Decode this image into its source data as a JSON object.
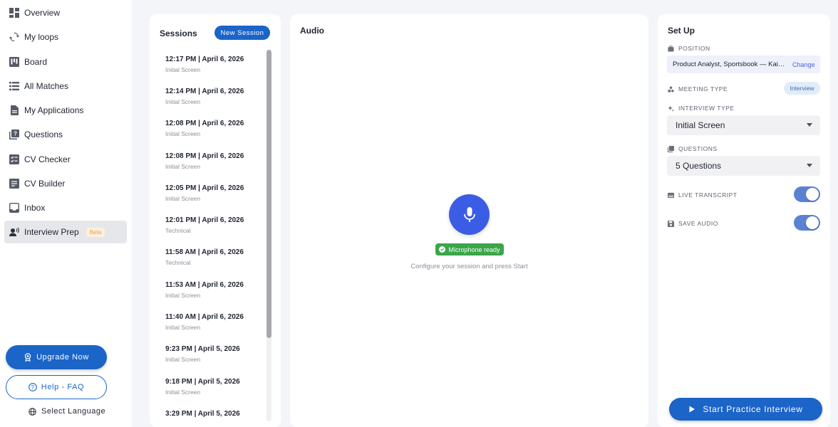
{
  "sidebar": {
    "items": [
      {
        "label": "Overview",
        "icon": "dashboard-icon"
      },
      {
        "label": "My loops",
        "icon": "refresh-icon"
      },
      {
        "label": "Board",
        "icon": "kanban-icon"
      },
      {
        "label": "All Matches",
        "icon": "list-icon"
      },
      {
        "label": "My Applications",
        "icon": "document-icon"
      },
      {
        "label": "Questions",
        "icon": "question-box-icon"
      },
      {
        "label": "CV Checker",
        "icon": "checklist-icon"
      },
      {
        "label": "CV Builder",
        "icon": "article-icon"
      },
      {
        "label": "Inbox",
        "icon": "inbox-icon"
      },
      {
        "label": "Interview Prep",
        "icon": "person-voice-icon",
        "badge": "Beta",
        "active": true
      }
    ],
    "upgrade_label": "Upgrade Now",
    "faq_label": "Help - FAQ",
    "language_label": "Select Language"
  },
  "sessions": {
    "title": "Sessions",
    "new_button": "New Session",
    "items": [
      {
        "time": "12:17 PM | April 6, 2026",
        "type": "Initial Screen"
      },
      {
        "time": "12:14 PM | April 6, 2026",
        "type": "Initial Screen"
      },
      {
        "time": "12:08 PM | April 6, 2026",
        "type": "Initial Screen"
      },
      {
        "time": "12:08 PM | April 6, 2026",
        "type": "Initial Screen"
      },
      {
        "time": "12:05 PM | April 6, 2026",
        "type": "Initial Screen"
      },
      {
        "time": "12:01 PM | April 6, 2026",
        "type": "Technical"
      },
      {
        "time": "11:58 AM | April 6, 2026",
        "type": "Technical"
      },
      {
        "time": "11:53 AM | April 6, 2026",
        "type": "Initial Screen"
      },
      {
        "time": "11:40 AM | April 6, 2026",
        "type": "Initial Screen"
      },
      {
        "time": "9:23 PM | April 5, 2026",
        "type": "Initial Screen"
      },
      {
        "time": "9:18 PM | April 5, 2026",
        "type": "Initial Screen"
      },
      {
        "time": "3:29 PM | April 5, 2026",
        "type": ""
      }
    ]
  },
  "audio": {
    "title": "Audio",
    "status": "Microphone ready",
    "hint": "Configure your session and press Start"
  },
  "setup": {
    "title": "Set Up",
    "position_label": "POSITION",
    "position_value": "Product Analyst, Sportsbook — Kaizen Gaming",
    "change_label": "Change",
    "meeting_type_label": "MEETING TYPE",
    "meeting_type_value": "Interview",
    "interview_type_label": "INTERVIEW TYPE",
    "interview_type_value": "Initial Screen",
    "questions_label": "QUESTIONS",
    "questions_value": "5 Questions",
    "live_transcript_label": "LIVE TRANSCRIPT",
    "live_transcript_on": true,
    "save_audio_label": "SAVE AUDIO",
    "save_audio_on": true,
    "start_label": "Start Practice Interview"
  },
  "colors": {
    "primary": "#1b64c8",
    "mic": "#3b5de6",
    "ready_green": "#3ba54a",
    "toggle_on": "#5b82d2"
  }
}
